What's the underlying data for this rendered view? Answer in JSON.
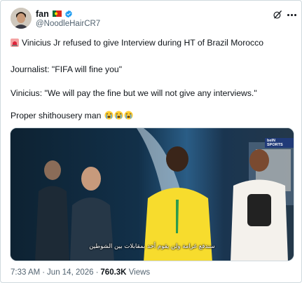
{
  "user": {
    "display_name": "fan",
    "handle": "@NoodleHairCR7"
  },
  "tweet": {
    "line1": "Vinicius Jr refused to give Interview during HT of Brazil Morocco",
    "line2": "Journalist: \"FIFA will fine you\"",
    "line3": "Vinicius: \"We will pay the fine but we will not give any interviews.\"",
    "line4": "Proper shithousery man"
  },
  "media": {
    "subtitle": "سندفع غرامة ولن يقوم أحد بمقابلات بين الشوطين",
    "channel_logo": "beIN SPORTS"
  },
  "meta": {
    "time": "7:33 AM",
    "separator": "·",
    "date": "Jun 14, 2026",
    "views_count": "760.3K",
    "views_label": "Views"
  },
  "icons": {
    "flag": "portugal-flag-icon",
    "verified": "verified-badge-icon",
    "grok": "grok-icon",
    "more": "more-options-icon",
    "siren": "police-light-icon",
    "emoji": "loudly-crying-face-icon"
  },
  "colors": {
    "accent": "#1d9bf0",
    "secondary_text": "#536471"
  }
}
